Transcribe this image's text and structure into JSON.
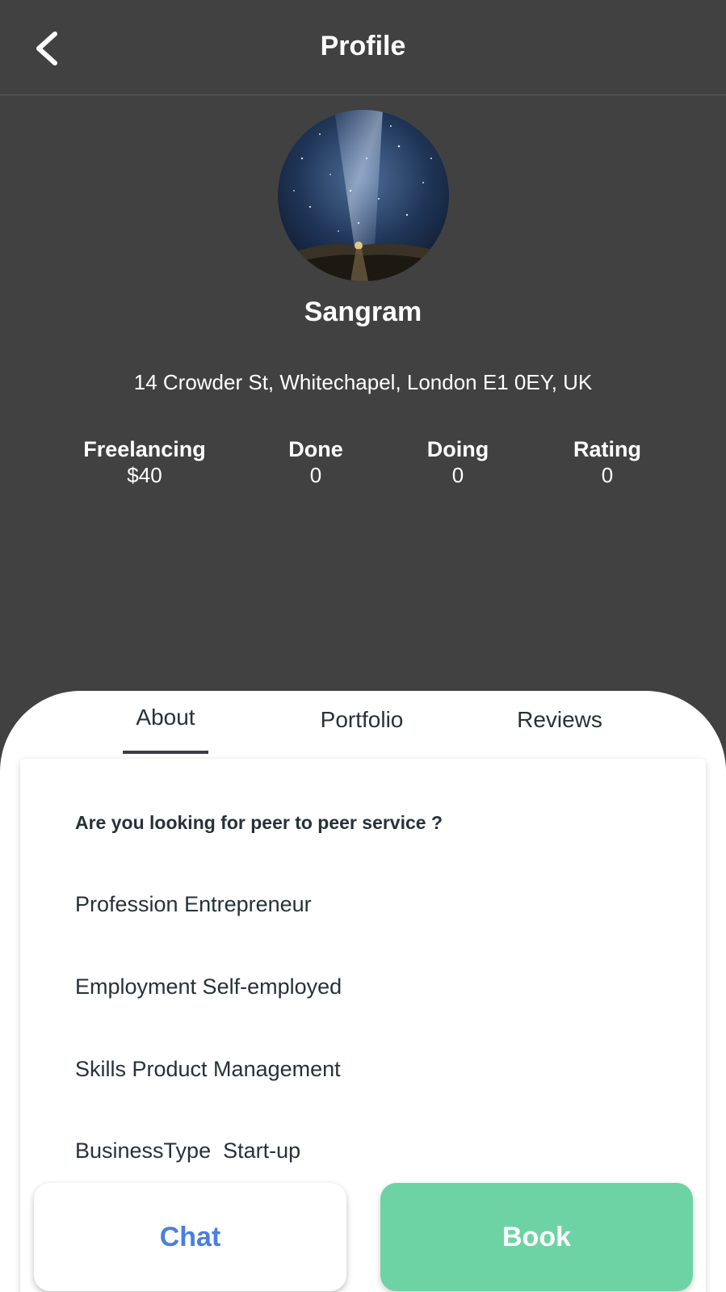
{
  "header": {
    "title": "Profile",
    "back_icon": "chevron-left-icon"
  },
  "profile": {
    "name": "Sangram",
    "address": "14 Crowder St, Whitechapel, London E1 0EY, UK",
    "avatar_description_icon": "starry-sky-avatar"
  },
  "stats": [
    {
      "label": "Freelancing",
      "value": "$40"
    },
    {
      "label": "Done",
      "value": "0"
    },
    {
      "label": "Doing",
      "value": "0"
    },
    {
      "label": "Rating",
      "value": "0"
    }
  ],
  "tabs": [
    {
      "label": "About",
      "active": true
    },
    {
      "label": "Portfolio",
      "active": false
    },
    {
      "label": "Reviews",
      "active": false
    }
  ],
  "about": {
    "question": "Are you looking for peer to peer service ?",
    "lines": [
      "Profession Entrepreneur",
      "Employment Self-employed",
      "Skills Product Management",
      "BusinessType  Start-up"
    ]
  },
  "actions": {
    "chat_label": "Chat",
    "book_label": "Book"
  },
  "colors": {
    "background": "#414141",
    "book_button": "#6ed3a4",
    "chat_text": "#4a7fe0",
    "text_dark": "#263238"
  }
}
